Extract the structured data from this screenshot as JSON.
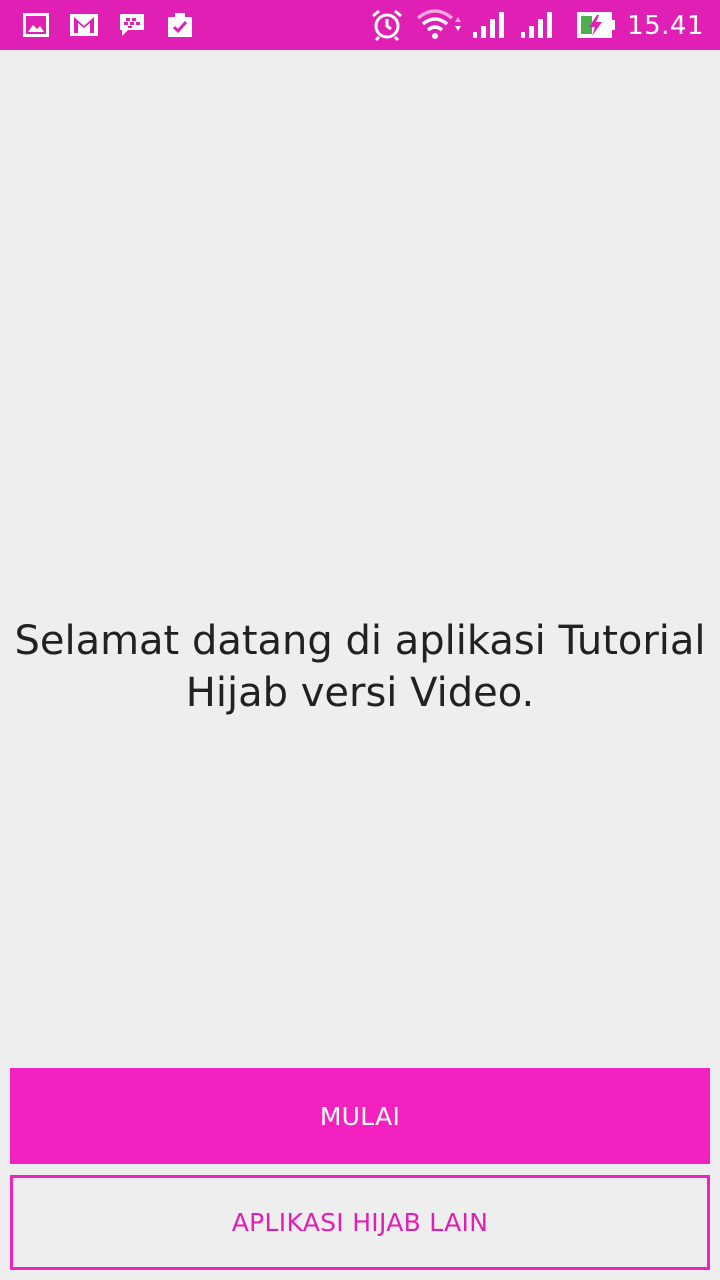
{
  "status_bar": {
    "time": "15.41",
    "icons": [
      "gallery-icon",
      "gmail-icon",
      "bbm-icon",
      "clipboard-check-icon",
      "alarm-icon",
      "wifi-icon",
      "signal-icon",
      "signal-icon",
      "battery-charging-icon"
    ],
    "background": "#e01fb4"
  },
  "main": {
    "welcome_line1": "Selamat datang di aplikasi Tutorial",
    "welcome_line2": "Hijab versi Video."
  },
  "buttons": {
    "start_label": "MULAI",
    "other_apps_label": "APLIKASI HIJAB LAIN"
  },
  "colors": {
    "accent": "#f421c1",
    "background": "#eeeeee",
    "text": "#212121"
  }
}
